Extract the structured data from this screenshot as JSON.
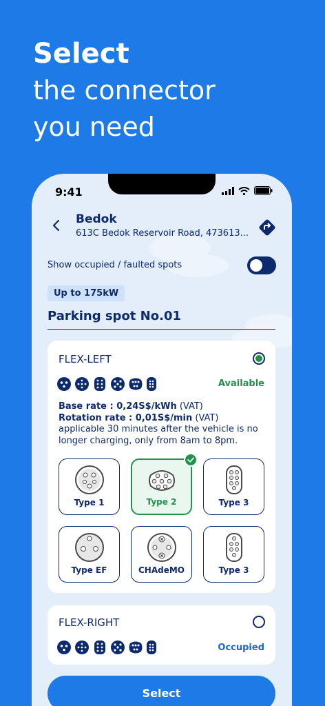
{
  "headline": {
    "line1": "Select",
    "line2": "the connector",
    "line3": "you need"
  },
  "status_bar": {
    "time": "9:41"
  },
  "location": {
    "name": "Bedok",
    "address": "613C Bedok Reservoir Road, 473613..."
  },
  "filters": {
    "show_occupied_label": "Show occupied / faulted spots",
    "power_badge": "Up to 175kW"
  },
  "spot_title": "Parking spot No.01",
  "cards": [
    {
      "title": "FLEX-LEFT",
      "status": "Available",
      "selected": true,
      "base_rate_label": "Base rate : ",
      "base_rate_value": "0,24S$/kWh",
      "base_rate_suffix": " (VAT)",
      "rotation_rate_label": "Rotation rate : ",
      "rotation_rate_value": "0,01S$/min",
      "rotation_rate_suffix": " (VAT) applicable 30 minutes after the vehicle is no longer charging, only from 8am to 8pm.",
      "connectors": [
        {
          "label": "Type 1",
          "icon": "type1-connector-icon",
          "selected": false
        },
        {
          "label": "Type 2",
          "icon": "type2-connector-icon",
          "selected": true
        },
        {
          "label": "Type 3",
          "icon": "type3-connector-icon",
          "selected": false
        },
        {
          "label": "Type EF",
          "icon": "typeef-connector-icon",
          "selected": false
        },
        {
          "label": "CHAdeMO",
          "icon": "chademo-connector-icon",
          "selected": false
        },
        {
          "label": "Type 3",
          "icon": "type3-connector-icon",
          "selected": false
        }
      ]
    },
    {
      "title": "FLEX-RIGHT",
      "status": "Occupied",
      "selected": false
    }
  ],
  "actions": {
    "select_label": "Select"
  },
  "colors": {
    "primary_blue": "#1d7ae6",
    "navy": "#0d2a6e",
    "available_green": "#22914c",
    "occupied_blue": "#1d64d6"
  }
}
